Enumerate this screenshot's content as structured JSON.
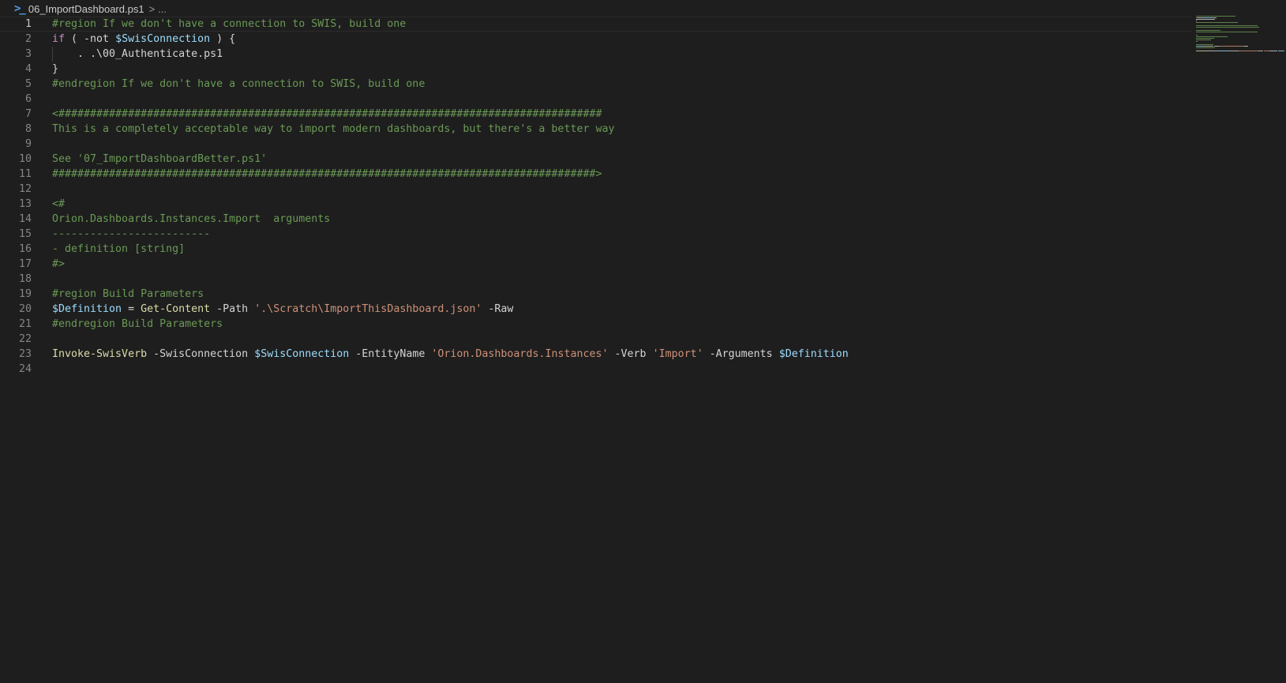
{
  "breadcrumb": {
    "file_name": "06_ImportDashboard.ps1",
    "separator": ">",
    "more": "...",
    "icon": "powershell-icon"
  },
  "colors": {
    "background": "#1e1e1e",
    "comment": "#6a9955",
    "keyword": "#c586c0",
    "variable": "#9cdcfe",
    "function": "#dcdcaa",
    "string": "#ce9178",
    "text": "#d4d4d4",
    "line_number": "#858585"
  },
  "active_line": 1,
  "lines": [
    {
      "n": "1",
      "tokens": [
        {
          "t": "#region If we don't have a connection to SWIS, build one",
          "c": "comment"
        }
      ]
    },
    {
      "n": "2",
      "tokens": [
        {
          "t": "if",
          "c": "kw"
        },
        {
          "t": " ( -not ",
          "c": "plain"
        },
        {
          "t": "$SwisConnection",
          "c": "var"
        },
        {
          "t": " ) {",
          "c": "plain"
        }
      ]
    },
    {
      "n": "3",
      "tokens": [
        {
          "t": "    . .\\00_Authenticate.ps1",
          "c": "plain"
        }
      ]
    },
    {
      "n": "4",
      "tokens": [
        {
          "t": "}",
          "c": "plain"
        }
      ]
    },
    {
      "n": "5",
      "tokens": [
        {
          "t": "#endregion If we don't have a connection to SWIS, build one",
          "c": "comment"
        }
      ]
    },
    {
      "n": "6",
      "tokens": []
    },
    {
      "n": "7",
      "tokens": [
        {
          "t": "<######################################################################################",
          "c": "comment"
        }
      ]
    },
    {
      "n": "8",
      "tokens": [
        {
          "t": "This is a completely acceptable way to import modern dashboards, but there's a better way",
          "c": "comment"
        }
      ]
    },
    {
      "n": "9",
      "tokens": []
    },
    {
      "n": "10",
      "tokens": [
        {
          "t": "See '07_ImportDashboardBetter.ps1'",
          "c": "comment"
        }
      ]
    },
    {
      "n": "11",
      "tokens": [
        {
          "t": "######################################################################################>",
          "c": "comment"
        }
      ]
    },
    {
      "n": "12",
      "tokens": []
    },
    {
      "n": "13",
      "tokens": [
        {
          "t": "<#",
          "c": "comment"
        }
      ]
    },
    {
      "n": "14",
      "tokens": [
        {
          "t": "Orion.Dashboards.Instances.Import  arguments",
          "c": "comment"
        }
      ]
    },
    {
      "n": "15",
      "tokens": [
        {
          "t": "-------------------------",
          "c": "comment"
        }
      ]
    },
    {
      "n": "16",
      "tokens": [
        {
          "t": "- definition [string]",
          "c": "comment"
        }
      ]
    },
    {
      "n": "17",
      "tokens": [
        {
          "t": "#>",
          "c": "comment"
        }
      ]
    },
    {
      "n": "18",
      "tokens": []
    },
    {
      "n": "19",
      "tokens": [
        {
          "t": "#region Build Parameters",
          "c": "comment"
        }
      ]
    },
    {
      "n": "20",
      "tokens": [
        {
          "t": "$Definition",
          "c": "var"
        },
        {
          "t": " = ",
          "c": "plain"
        },
        {
          "t": "Get-Content",
          "c": "fn"
        },
        {
          "t": " -Path ",
          "c": "plain"
        },
        {
          "t": "'.\\Scratch\\ImportThisDashboard.json'",
          "c": "str"
        },
        {
          "t": " -Raw",
          "c": "plain"
        }
      ]
    },
    {
      "n": "21",
      "tokens": [
        {
          "t": "#endregion Build Parameters",
          "c": "comment"
        }
      ]
    },
    {
      "n": "22",
      "tokens": []
    },
    {
      "n": "23",
      "tokens": [
        {
          "t": "Invoke-SwisVerb",
          "c": "fn"
        },
        {
          "t": " -SwisConnection ",
          "c": "plain"
        },
        {
          "t": "$SwisConnection",
          "c": "var"
        },
        {
          "t": " -EntityName ",
          "c": "plain"
        },
        {
          "t": "'Orion.Dashboards.Instances'",
          "c": "str"
        },
        {
          "t": " -Verb ",
          "c": "plain"
        },
        {
          "t": "'Import'",
          "c": "str"
        },
        {
          "t": " -Arguments ",
          "c": "plain"
        },
        {
          "t": "$Definition",
          "c": "var"
        }
      ]
    },
    {
      "n": "24",
      "tokens": []
    }
  ]
}
